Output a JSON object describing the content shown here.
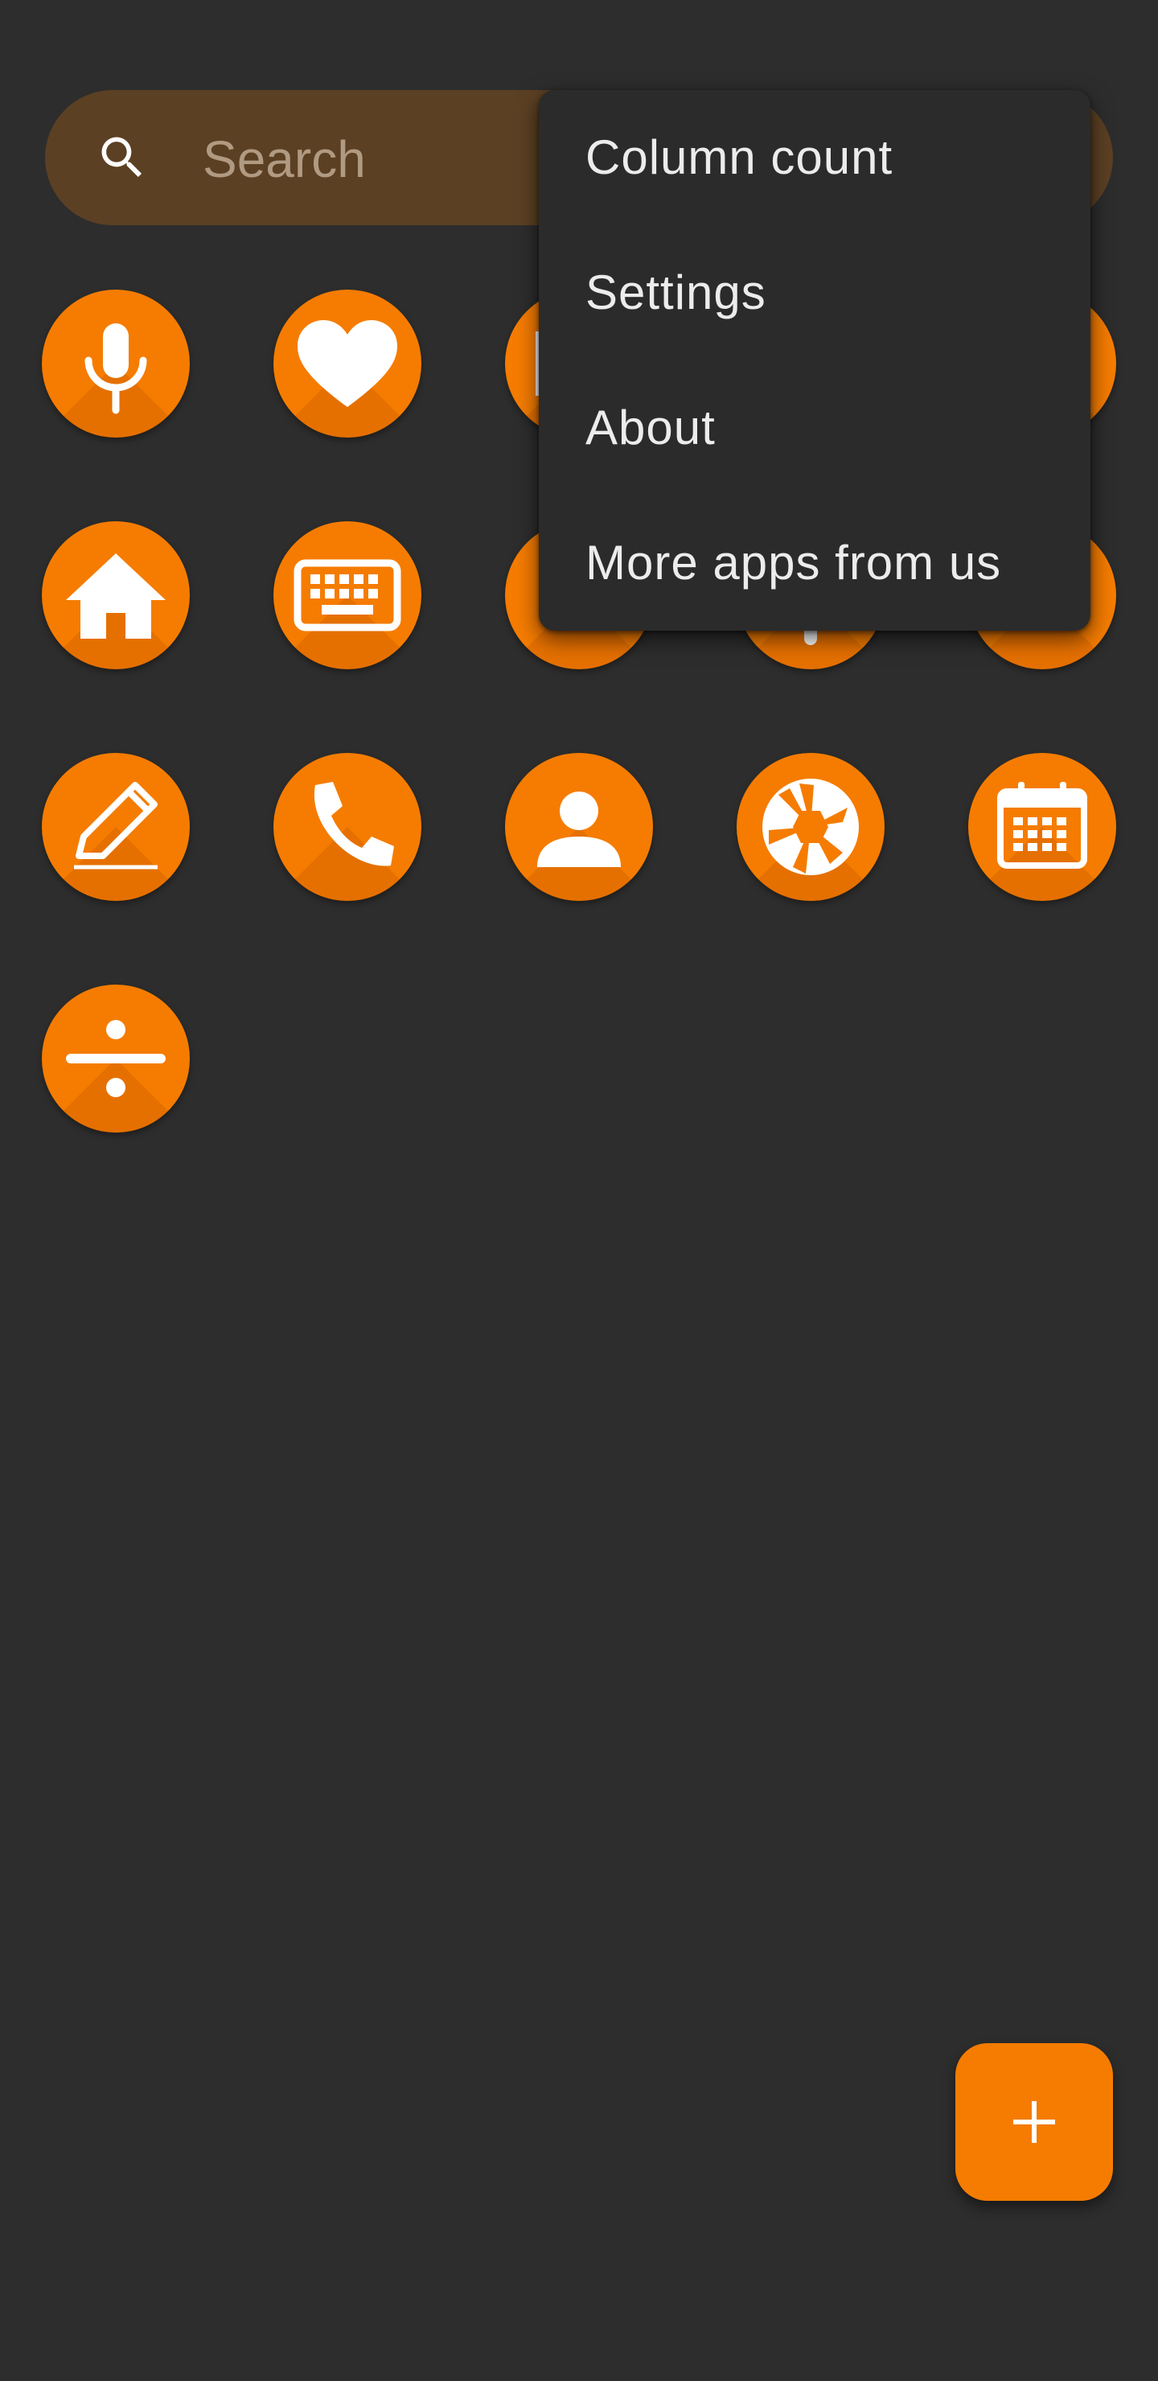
{
  "search": {
    "placeholder": "Search",
    "icon": "search-icon"
  },
  "grid": {
    "accent_color": "#f57c00",
    "icons": [
      {
        "name": "microphone-icon"
      },
      {
        "name": "heart-icon"
      },
      {
        "name": "partially-hidden-icon"
      },
      {
        "name": "partially-hidden-icon"
      },
      {
        "name": "partially-hidden-icon"
      },
      {
        "name": "home-icon"
      },
      {
        "name": "keyboard-icon"
      },
      {
        "name": "partially-hidden-icon"
      },
      {
        "name": "partially-hidden-icon"
      },
      {
        "name": "partially-hidden-icon"
      },
      {
        "name": "pencil-icon"
      },
      {
        "name": "phone-icon"
      },
      {
        "name": "person-icon"
      },
      {
        "name": "camera-aperture-icon"
      },
      {
        "name": "calendar-icon"
      },
      {
        "name": "divide-icon"
      }
    ]
  },
  "menu": {
    "items": [
      {
        "label": "Column count"
      },
      {
        "label": "Settings"
      },
      {
        "label": "About"
      },
      {
        "label": "More apps from us"
      }
    ]
  },
  "fab": {
    "icon": "plus-icon"
  },
  "colors": {
    "background": "#2d2d2d",
    "accent": "#f57c00",
    "search_background": "#5c4023",
    "menu_background": "#2b2b2b"
  }
}
